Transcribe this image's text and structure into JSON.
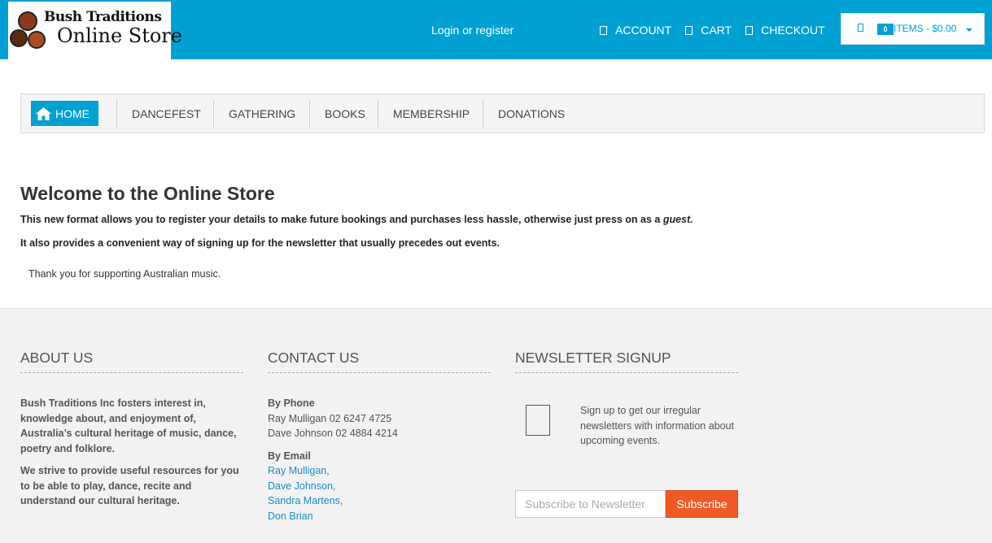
{
  "header": {
    "logo_line1": "Bush Traditions",
    "logo_line2": "Online Store",
    "login_label": "Login or register",
    "links": [
      {
        "label": "ACCOUNT",
        "icon": "user-icon"
      },
      {
        "label": "CART",
        "icon": "cart-icon"
      },
      {
        "label": "CHECKOUT",
        "icon": "checkout-icon"
      }
    ],
    "cart": {
      "count": "0",
      "summary": "ITEMS - $0.00"
    },
    "colors": {
      "accent": "#00a0d2"
    }
  },
  "nav": {
    "home_label": "HOME",
    "items": [
      "DANCEFEST",
      "GATHERING",
      "BOOKS",
      "MEMBERSHIP",
      "DONATIONS"
    ]
  },
  "main": {
    "title": "Welcome to the Online Store",
    "para1": "This new format allows you to register your details to make future bookings and purchases less hassle, otherwise just press on as a",
    "para1_em": "guest.",
    "para2": "It also provides a convenient way of signing up for the newsletter that usually precedes out events.",
    "para3": "Thank you for supporting Australian music."
  },
  "footer": {
    "about": {
      "heading": "ABOUT US",
      "p1": "Bush Traditions Inc fosters interest in, knowledge about, and enjoyment of, Australia’s cultural heritage of music, dance, poetry and folklore.",
      "p2": "We strive to provide useful resources for you to be able to play, dance, recite and understand our cultural heritage."
    },
    "contact": {
      "heading": "CONTACT US",
      "phone_title": "By Phone",
      "phones": [
        "Ray Mulligan 02 6247 4725",
        "Dave Johnson 02 4884 4214"
      ],
      "email_title": "By Email",
      "emails": [
        "Ray Mulligan,",
        "Dave Johnson,",
        "Sandra Martens,",
        "Don Brian"
      ]
    },
    "newsletter": {
      "heading": "NEWSLETTER SIGNUP",
      "text": "Sign up to get our irregular newsletters with information about upcoming events.",
      "placeholder": "Subscribe to Newsletter",
      "button": "Subscribe",
      "button_color": "#f05a24"
    }
  }
}
